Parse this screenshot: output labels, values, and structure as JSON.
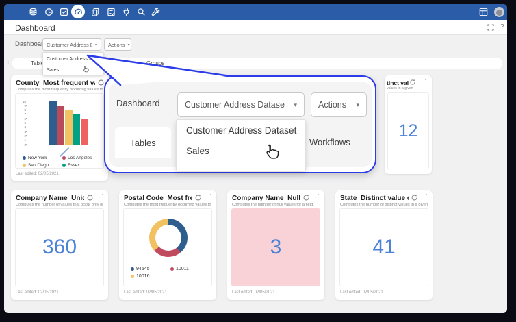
{
  "glyphs": {
    "caret_down": "▾",
    "chevron_left": "‹",
    "kebab": "⋮",
    "help": "?"
  },
  "colors": {
    "topbar": "#2a5ca8",
    "accent_blue": "#4b82d8",
    "bubble_border": "#2b3ce8",
    "pink_bg": "#f8d2d6",
    "bar_colors": [
      "#2e5e8e",
      "#b94a5c",
      "#f2c161",
      "#00a287",
      "#ef6262"
    ],
    "donut_colors": [
      "#2e5e8e",
      "#c04a5e",
      "#f2c161"
    ]
  },
  "topbar": {
    "icons": [
      "database",
      "history",
      "tasks",
      "dashboard",
      "copy",
      "notebook",
      "plug",
      "search",
      "wrench"
    ],
    "right_icons": [
      "apps-grid",
      "avatar"
    ]
  },
  "header": {
    "title": "Dashboard"
  },
  "toolbar": {
    "context_label": "Dashboard",
    "dataset_value": "Customer Address Datase",
    "actions_label": "Actions",
    "menu_options": [
      "Customer Address Dataset",
      "Sales"
    ]
  },
  "tabs": {
    "items": [
      "Tables",
      "Workflows",
      "Groups"
    ]
  },
  "callout": {
    "context_label": "Dashboard",
    "dataset_value": "Customer Address Datase",
    "actions_label": "Actions",
    "tab_left": "Tables",
    "tab_right": "Workflows",
    "menu_options": [
      "Customer Address Dataset",
      "Sales"
    ]
  },
  "cards": {
    "county": {
      "title": "County_Most frequent values",
      "subtitle": "Computes the most frequently occurring values for ...",
      "footer": "Last edited: 02/05/2021",
      "chart_data": {
        "type": "bar",
        "categories": [
          "New York",
          "Los Angeles",
          "San Diego",
          "Essex",
          ""
        ],
        "values": [
          10,
          9,
          8,
          7,
          6
        ],
        "colors": [
          "#2e5e8e",
          "#b94a5c",
          "#f2c161",
          "#00a287",
          "#ef6262"
        ],
        "ylim": [
          0,
          10
        ],
        "legend": [
          "New York",
          "Los Angeles",
          "San Diego",
          "Essex"
        ]
      }
    },
    "distinct_partial": {
      "title_visible": "tinct value ...",
      "subtitle_visible": "values in a given ...",
      "value": "12"
    },
    "company_unique": {
      "title": "Company Name_Unique co...",
      "subtitle": "Computes the number of values that occur only once.",
      "value": "360",
      "footer": "Last edited: 02/05/2021"
    },
    "postal": {
      "title": "Postal Code_Most frequent...",
      "subtitle": "Computes the most frequently occurring values for ...",
      "footer": "Last edited: 02/05/2021",
      "chart_data": {
        "type": "donut",
        "labels": [
          "94545",
          "10011",
          "10016"
        ],
        "fractions": [
          0.39,
          0.24,
          0.37
        ],
        "colors": [
          "#2e5e8e",
          "#c04a5e",
          "#f2c161"
        ]
      }
    },
    "company_null": {
      "title": "Company Name_Null count",
      "subtitle": "Computes the number of null values for a field.",
      "value": "3",
      "footer": "Last edited: 02/05/2021"
    },
    "state": {
      "title": "State_Distinct value count",
      "subtitle": "Computes the number of distinct values in a given ...",
      "value": "41",
      "footer": "Last edited: 02/05/2021"
    }
  }
}
